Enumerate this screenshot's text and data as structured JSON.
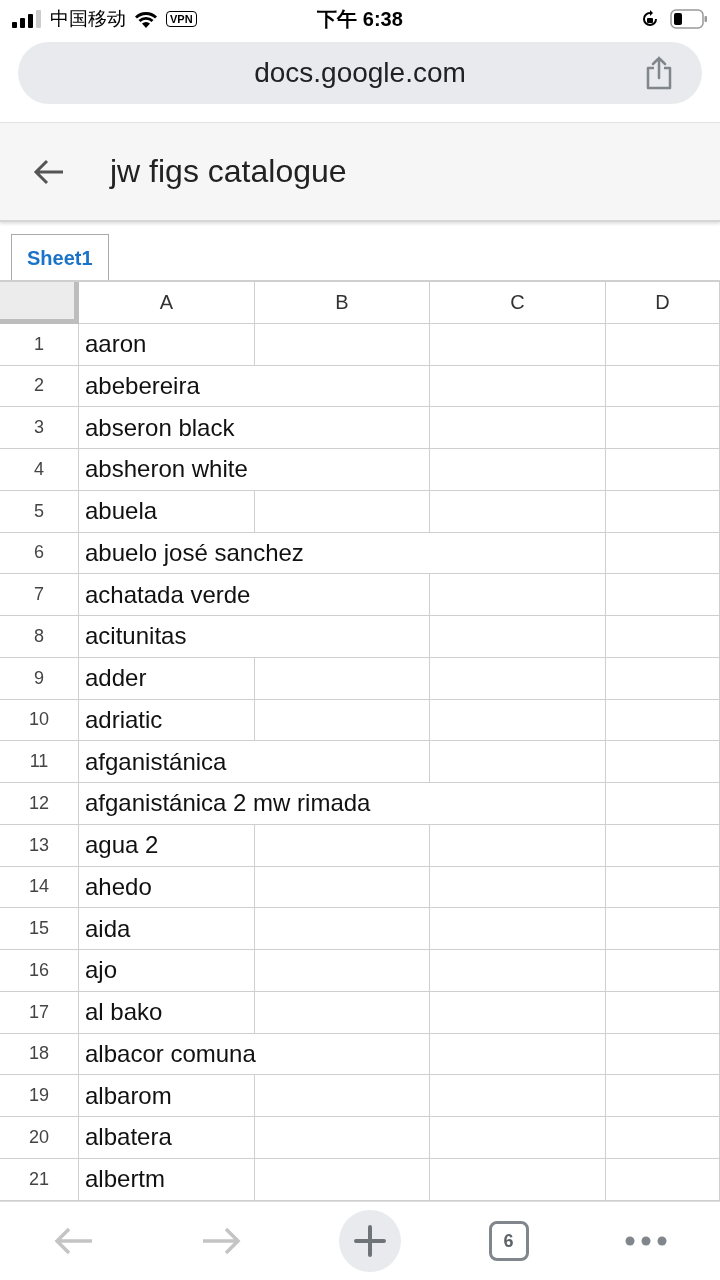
{
  "status_bar": {
    "carrier": "中国移动",
    "vpn": "VPN",
    "time": "下午 6:38"
  },
  "address_bar": {
    "url": "docs.google.com"
  },
  "document": {
    "title": "jw figs catalogue"
  },
  "sheet_tabs": [
    {
      "label": "Sheet1",
      "selected": true
    }
  ],
  "columns": [
    "A",
    "B",
    "C",
    "D"
  ],
  "rows": [
    {
      "number": "1",
      "value": "aaron"
    },
    {
      "number": "2",
      "value": "abebereira"
    },
    {
      "number": "3",
      "value": "abseron black"
    },
    {
      "number": "4",
      "value": "absheron white"
    },
    {
      "number": "5",
      "value": "abuela"
    },
    {
      "number": "6",
      "value": "abuelo josé sanchez"
    },
    {
      "number": "7",
      "value": "achatada verde"
    },
    {
      "number": "8",
      "value": "acitunitas"
    },
    {
      "number": "9",
      "value": "adder"
    },
    {
      "number": "10",
      "value": "adriatic"
    },
    {
      "number": "11",
      "value": "afganistánica"
    },
    {
      "number": "12",
      "value": "afganistánica 2 mw rimada"
    },
    {
      "number": "13",
      "value": "agua 2"
    },
    {
      "number": "14",
      "value": "ahedo"
    },
    {
      "number": "15",
      "value": "aida"
    },
    {
      "number": "16",
      "value": "ajo"
    },
    {
      "number": "17",
      "value": "al bako"
    },
    {
      "number": "18",
      "value": "albacor comuna"
    },
    {
      "number": "19",
      "value": "albarom"
    },
    {
      "number": "20",
      "value": "albatera"
    },
    {
      "number": "21",
      "value": "albertm"
    }
  ],
  "bottom_bar": {
    "nav": [
      {
        "kind": "back",
        "disabled": true
      },
      {
        "kind": "forward",
        "disabled": true
      }
    ],
    "tab_count": "6"
  }
}
